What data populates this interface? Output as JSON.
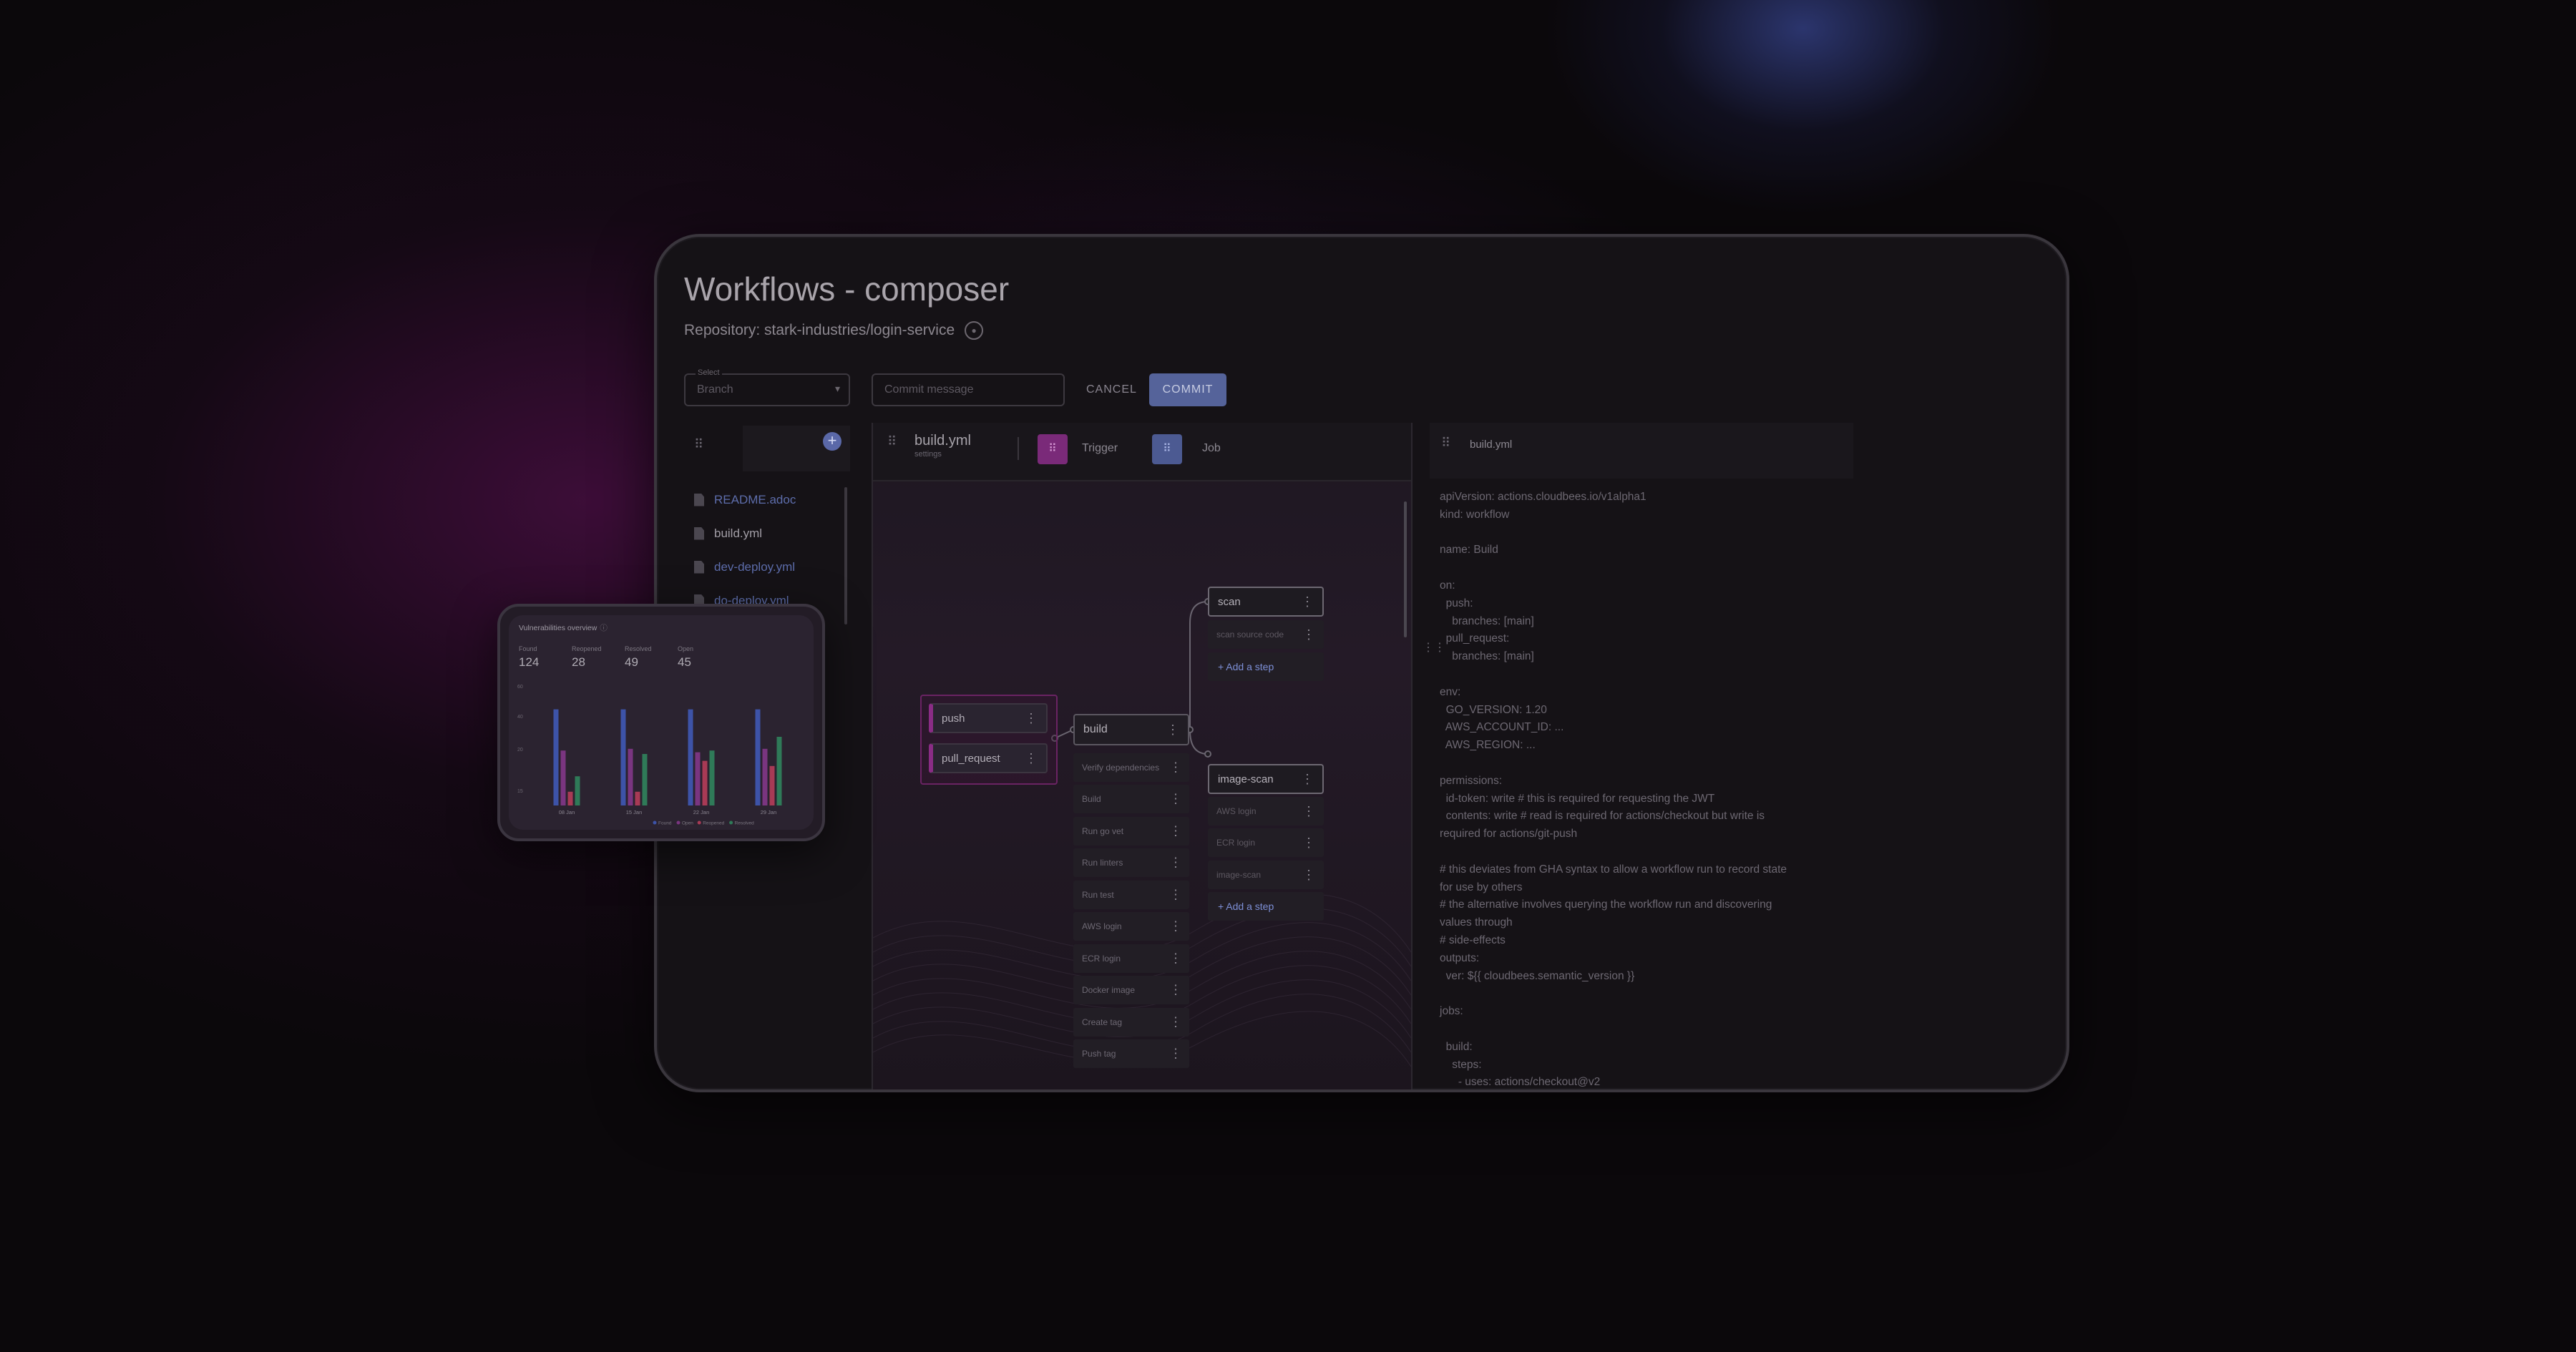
{
  "composer": {
    "title": "Workflows - composer",
    "repository_text": "Repository: stark-industries/login-service",
    "branch_select": {
      "label": "Select",
      "value": "Branch"
    },
    "commit_message_placeholder": "Commit message",
    "cancel_label": "CANCEL",
    "commit_label": "COMMIT"
  },
  "files": [
    "README.adoc",
    "build.yml",
    "dev-deploy.yml",
    "do-deploy.yml"
  ],
  "active_file": "build.yml",
  "workflow": {
    "file": "build.yml",
    "subtitle": "settings",
    "trigger_label": "Trigger",
    "job_label": "Job",
    "triggers": [
      "push",
      "pull_request"
    ],
    "build_job": "build",
    "build_steps": [
      "Verify dependencies",
      "Build",
      "Run go vet",
      "Run linters",
      "Run test",
      "AWS login",
      "ECR login",
      "Docker image",
      "Create tag",
      "Push tag"
    ],
    "scan_job": "scan",
    "scan_steps": [
      "scan source code"
    ],
    "image_scan_job": "image-scan",
    "image_scan_steps": [
      "AWS login",
      "ECR login",
      "image-scan"
    ],
    "add_step_label": "+ Add a step"
  },
  "code": {
    "file": "build.yml",
    "lines": [
      "apiVersion: actions.cloudbees.io/v1alpha1",
      "kind: workflow",
      "",
      "name: Build",
      "",
      "on:",
      "  push:",
      "    branches: [main]",
      "  pull_request:",
      "    branches: [main]",
      "",
      "env:",
      "  GO_VERSION: 1.20",
      "  AWS_ACCOUNT_ID: ...",
      "  AWS_REGION: ...",
      "",
      "permissions:",
      "  id-token: write # this is required for requesting the JWT",
      "  contents: write # read is required for actions/checkout but write is",
      "required for actions/git-push",
      "",
      "# this deviates from GHA syntax to allow a workflow run to record state",
      "for use by others",
      "# the alternative involves querying the workflow run and discovering",
      "values through",
      "# side-effects",
      "outputs:",
      "  ver: ${{ cloudbees.semantic_version }}",
      "",
      "jobs:",
      "",
      "  build:",
      "    steps:",
      "      - uses: actions/checkout@v2"
    ]
  },
  "vulnerabilities": {
    "title": "Vulnerabilities overview",
    "stats": [
      {
        "label": "Found",
        "value": "124"
      },
      {
        "label": "Reopened",
        "value": "28"
      },
      {
        "label": "Resolved",
        "value": "49"
      },
      {
        "label": "Open",
        "value": "45"
      }
    ]
  },
  "colors": {
    "found": "#3d53a8",
    "open": "#7a3580",
    "reopened": "#a83a55",
    "resolved": "#2f7a58"
  },
  "chart_data": {
    "type": "bar",
    "title": "Vulnerabilities overview",
    "categories": [
      "08 Jan",
      "15 Jan",
      "22 Jan",
      "29 Jan"
    ],
    "y_ticks": [
      "60",
      "40",
      "20",
      "15"
    ],
    "series": [
      {
        "name": "Found",
        "values": [
          56,
          56,
          56,
          56
        ]
      },
      {
        "name": "Open",
        "values": [
          32,
          33,
          31,
          33
        ]
      },
      {
        "name": "Reopened",
        "values": [
          8,
          8,
          26,
          23
        ]
      },
      {
        "name": "Resolved",
        "values": [
          17,
          30,
          32,
          40
        ]
      }
    ],
    "ylim": [
      0,
      70
    ],
    "legend_placement": "bottom-right"
  }
}
